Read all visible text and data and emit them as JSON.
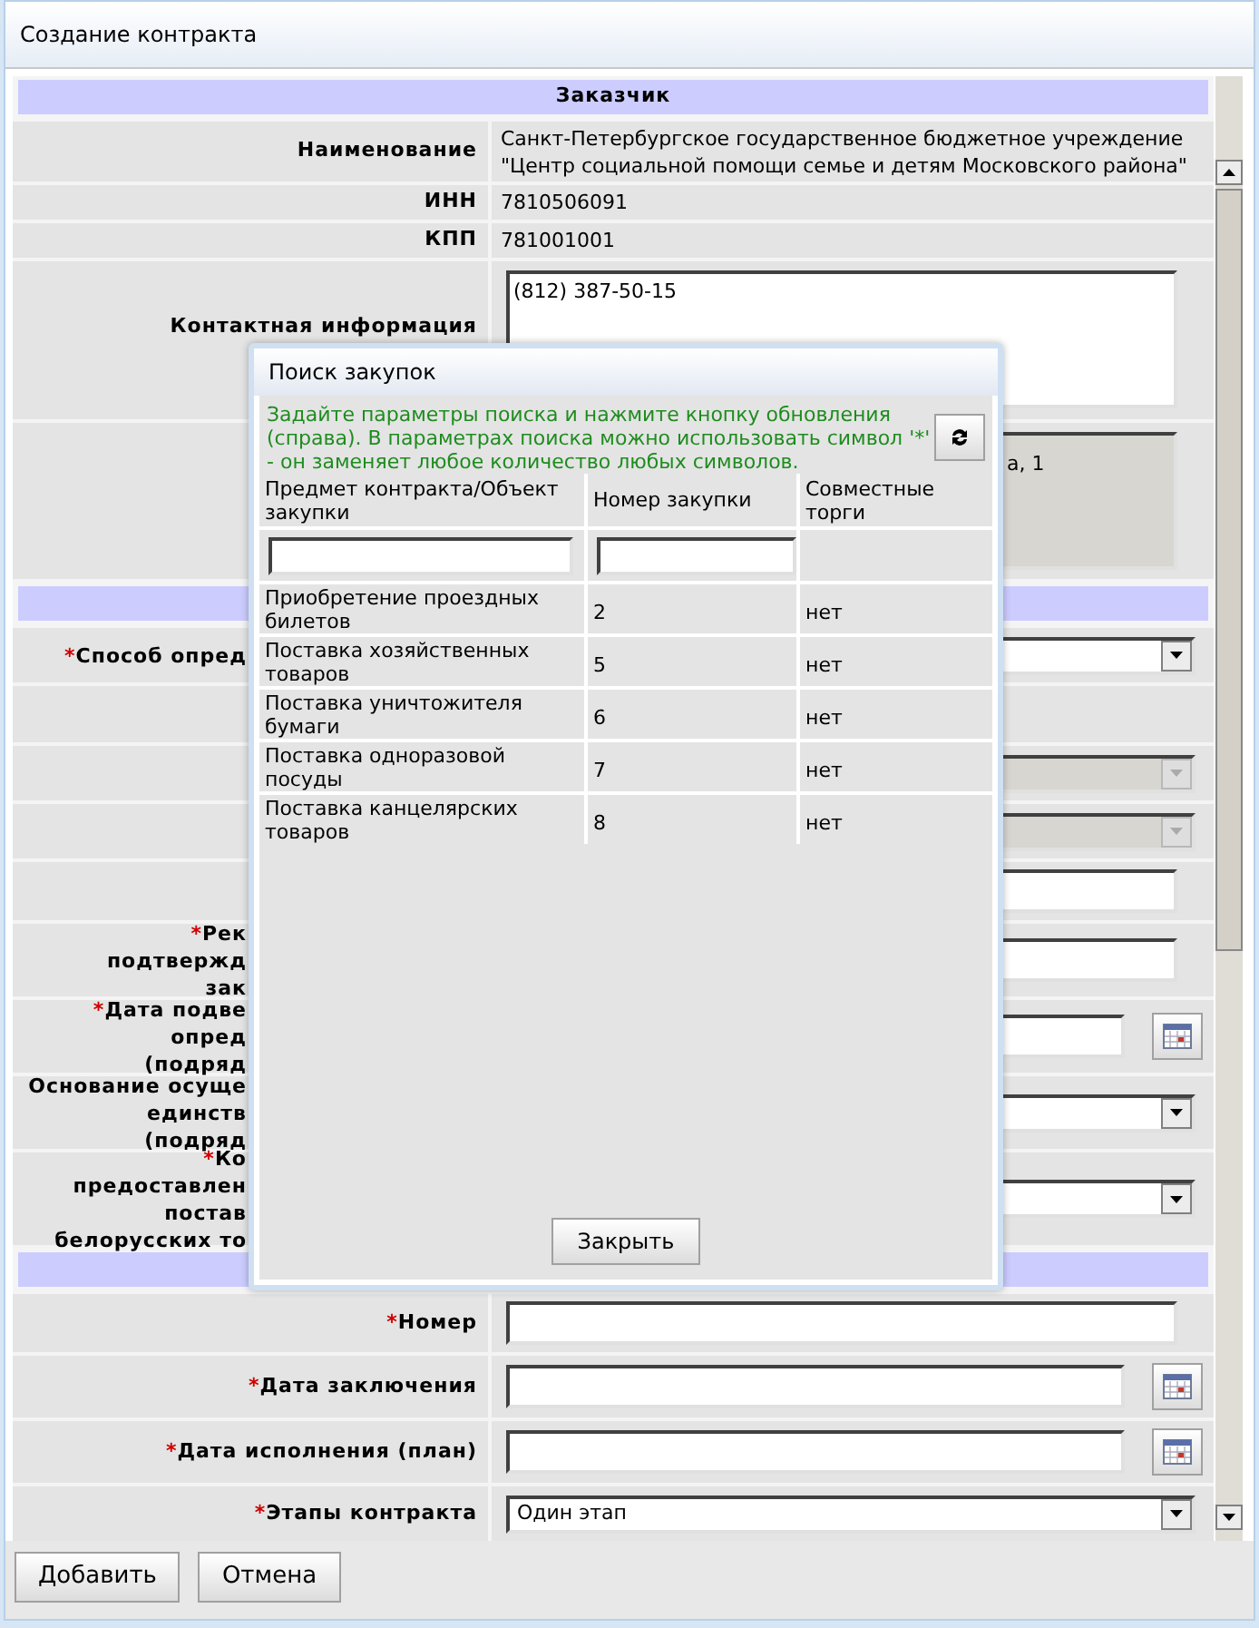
{
  "window": {
    "title": "Создание контракта"
  },
  "form": {
    "rows": [
      {
        "kind": "section",
        "title": "Заказчик"
      },
      {
        "kind": "text",
        "label": "Наименование",
        "lines": [
          "Санкт-Петербургское государственное бюджетное учреждение",
          "\"Центр социальной помощи семье и детям Московского района\""
        ]
      },
      {
        "kind": "text",
        "label": "ИНН",
        "lines": [
          "7810506091"
        ]
      },
      {
        "kind": "text",
        "label": "КПП",
        "lines": [
          "781001001"
        ]
      },
      {
        "kind": "textarea",
        "label": "Контактная информация",
        "value": "(812) 387-50-15",
        "disabled": false
      },
      {
        "kind": "textarea",
        "value": "а, 1",
        "disabled": true
      },
      {
        "kind": "section"
      },
      {
        "kind": "select",
        "required_mark": "*",
        "label_lines": [
          "Способ опред"
        ],
        "disabled": false
      },
      {
        "kind": "search"
      },
      {
        "kind": "select",
        "disabled": true
      },
      {
        "kind": "select",
        "disabled": true
      },
      {
        "kind": "input"
      },
      {
        "kind": "input",
        "required_mark": "*",
        "label_lines": [
          "Рек",
          "подтвержд",
          "зак"
        ]
      },
      {
        "kind": "date",
        "required_mark": "*",
        "label_lines": [
          "Дата подве",
          "опред",
          "(подряд"
        ]
      },
      {
        "kind": "select",
        "label_lines": [
          "Основание осуще",
          "единств",
          "(подряд"
        ],
        "disabled": false
      },
      {
        "kind": "select",
        "required_mark": "*",
        "label_lines": [
          "Ко",
          "предоставлен",
          "постав",
          "белорусских то"
        ],
        "disabled": false
      },
      {
        "kind": "section"
      },
      {
        "kind": "input",
        "required_mark": "*",
        "label": "Номер"
      },
      {
        "kind": "date",
        "required_mark": "*",
        "label": "Дата заключения"
      },
      {
        "kind": "date",
        "required_mark": "*",
        "label": "Дата исполнения (план)"
      },
      {
        "kind": "select",
        "required_mark": "*",
        "label": "Этапы контракта",
        "value": "Один этап",
        "disabled": false
      }
    ]
  },
  "buttons": [
    "Добавить",
    "Отмена"
  ],
  "dialog": {
    "title": "Поиск закупок",
    "hint": "Задайте параметры поиска и нажмите кнопку обновления (справа). В параметрах поиска можно использовать символ '*' - он заменяет любое количество любых символов.",
    "columns": [
      "Предмет контракта/Объект закупки",
      "Номер закупки",
      "Совместные торги"
    ],
    "rows": [
      [
        "Приобретение проездных билетов",
        "2",
        "нет"
      ],
      [
        "Поставка хозяйственных товаров",
        "5",
        "нет"
      ],
      [
        "Поставка уничтожителя бумаги",
        "6",
        "нет"
      ],
      [
        "Поставка одноразовой посуды",
        "7",
        "нет"
      ],
      [
        "Поставка канцелярских товаров",
        "8",
        "нет"
      ]
    ],
    "close_button": "Закрыть"
  }
}
